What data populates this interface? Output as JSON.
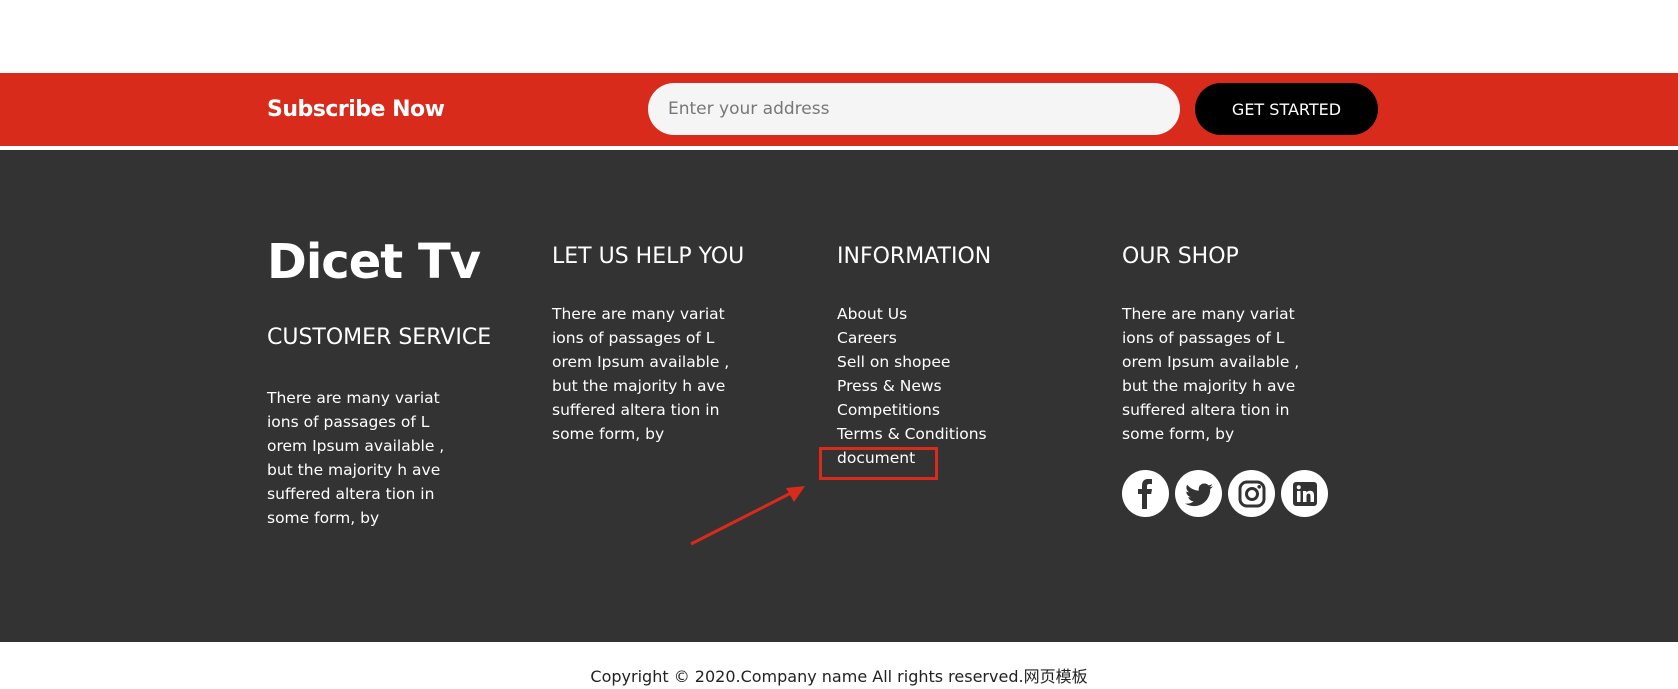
{
  "subscribe": {
    "title": "Subscribe Now",
    "input_placeholder": "Enter your address",
    "button_label": "GET STARTED"
  },
  "footer": {
    "brand": "Dicet Tv",
    "customer_service": {
      "title": "CUSTOMER SERVICE",
      "text": "There are many variat ions of passages of L orem Ipsum available , but the majority h ave suffered altera tion in some form, by"
    },
    "help": {
      "title": "LET US HELP YOU",
      "text": "There are many variat ions of passages of L orem Ipsum available , but the majority h ave suffered altera tion in some form, by"
    },
    "information": {
      "title": "INFORMATION",
      "links": [
        "About Us",
        "Careers",
        "Sell on shopee",
        "Press & News",
        "Competitions",
        "Terms & Conditions",
        "document"
      ]
    },
    "shop": {
      "title": "OUR SHOP",
      "text": "There are many variat ions of passages of L orem Ipsum available , but the majority h ave suffered altera tion in some form, by",
      "social_icons": [
        "facebook-icon",
        "twitter-icon",
        "instagram-icon",
        "linkedin-icon"
      ]
    }
  },
  "copyright": "Copyright © 2020.Company name All rights reserved.网页模板",
  "colors": {
    "accent_red": "#d82b1c",
    "footer_bg": "#333333",
    "button_bg": "#000000"
  }
}
